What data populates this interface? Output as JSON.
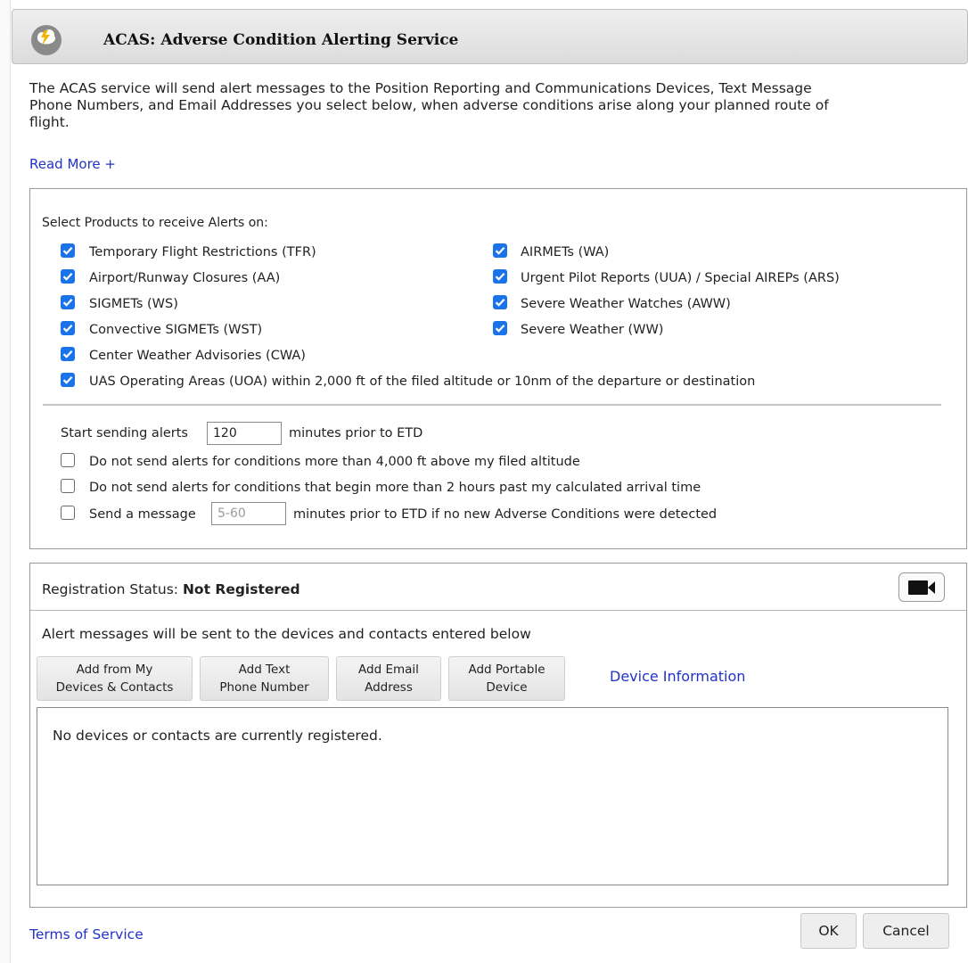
{
  "dialog": {
    "title": "ACAS: Adverse Condition Alerting Service",
    "title_icon": "weather-alert-icon",
    "intro_lines": [
      "The ACAS service will send alert messages to the Position Reporting and Communications Devices, Text Message",
      "Phone Numbers, and Email Addresses you select below, when adverse conditions arise along your planned route of",
      "flight."
    ],
    "read_more": "Read More +"
  },
  "products": {
    "heading": "Select Products to receive Alerts on:",
    "left": [
      {
        "label": "Temporary Flight Restrictions (TFR)",
        "checked": true
      },
      {
        "label": "Airport/Runway Closures (AA)",
        "checked": true
      },
      {
        "label": "SIGMETs (WS)",
        "checked": true
      },
      {
        "label": "Convective SIGMETs (WST)",
        "checked": true
      },
      {
        "label": "Center Weather Advisories (CWA)",
        "checked": true
      }
    ],
    "right": [
      {
        "label": "AIRMETs (WA)",
        "checked": true
      },
      {
        "label": "Urgent Pilot Reports (UUA) / Special AIREPs (ARS)",
        "checked": true
      },
      {
        "label": "Severe Weather Watches (AWW)",
        "checked": true
      },
      {
        "label": "Severe Weather (WW)",
        "checked": true
      }
    ],
    "uoa": {
      "label": "UAS Operating Areas (UOA) within 2,000 ft of the filed altitude or 10nm of the departure or destination",
      "checked": true
    }
  },
  "timing": {
    "start_prefix": "Start sending alerts",
    "start_value": "120",
    "start_suffix": "minutes prior to ETD",
    "option_altitude": "Do not send alerts for conditions more than 4,000 ft above my filed altitude",
    "option_arrival": "Do not send alerts for conditions that begin more than 2 hours past my calculated arrival time",
    "send_prefix": "Send a message",
    "send_placeholder": "5-60",
    "send_suffix": "minutes prior to ETD if no new Adverse Conditions were detected"
  },
  "registration": {
    "status_label": "Registration Status:",
    "status_value": "Not Registered",
    "video_icon": "video-camera-icon",
    "alert_text": "Alert messages will be sent to the devices and contacts entered below",
    "buttons": [
      {
        "line1": "Add from My",
        "line2": "Devices & Contacts"
      },
      {
        "line1": "Add Text",
        "line2": "Phone Number"
      },
      {
        "line1": "Add Email",
        "line2": "Address"
      },
      {
        "line1": "Add Portable",
        "line2": "Device"
      }
    ],
    "device_info_link": "Device Information",
    "empty_message": "No devices or contacts are currently registered."
  },
  "footer": {
    "terms": "Terms of Service",
    "ok": "OK",
    "cancel": "Cancel"
  },
  "colors": {
    "checkbox": "#1a73e8",
    "link": "#2232c8"
  }
}
